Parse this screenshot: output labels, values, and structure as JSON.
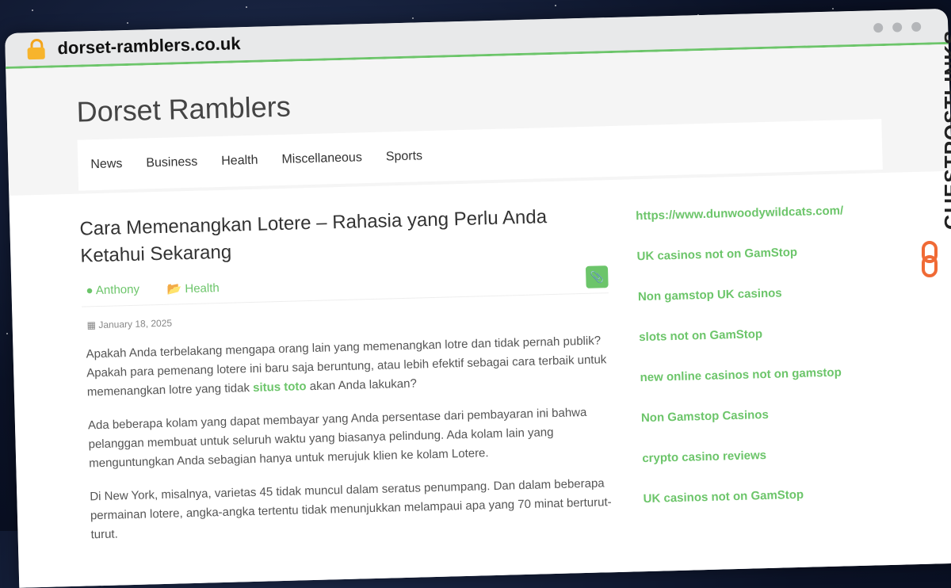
{
  "browser": {
    "url": "dorset-ramblers.co.uk",
    "accent_color": "#6cc56a",
    "lock_icon": "lock-icon"
  },
  "site": {
    "title": "Dorset Ramblers",
    "nav": [
      "News",
      "Business",
      "Health",
      "Miscellaneous",
      "Sports"
    ]
  },
  "article": {
    "title": "Cara Memenangkan Lotere – Rahasia yang Perlu Anda Ketahui Sekarang",
    "author": "Anthony",
    "category": "Health",
    "date": "January 18, 2025",
    "p1_a": "Apakah Anda terbelakang mengapa orang lain yang memenangkan lotre dan tidak pernah publik? Apakah para pemenang lotere ini baru saja beruntung, atau lebih efektif sebagai cara terbaik untuk memenangkan lotre yang tidak ",
    "p1_link": "situs toto",
    "p1_b": " akan Anda lakukan?",
    "p2": "Ada beberapa kolam yang dapat membayar yang Anda persentase dari pembayaran ini bahwa pelanggan membuat untuk seluruh waktu yang biasanya pelindung. Ada kolam lain yang menguntungkan Anda sebagian hanya untuk merujuk klien ke kolam Lotere.",
    "p3": "Di New York, misalnya, varietas 45 tidak muncul dalam seratus penumpang. Dan dalam beberapa permainan lotere, angka-angka tertentu tidak menunjukkan melampaui apa yang 70 minat berturut-turut."
  },
  "sidebar": {
    "links": [
      "https://www.dunwoodywildcats.com/",
      "UK casinos not on GamStop",
      "Non gamstop UK casinos",
      "slots not on GamStop",
      "new online casinos not on gamstop",
      "Non Gamstop Casinos",
      "crypto casino reviews",
      "UK casinos not on GamStop"
    ]
  },
  "watermark": {
    "text": "GUESTPOSTLINKS",
    "icon_color": "#f06a35"
  }
}
